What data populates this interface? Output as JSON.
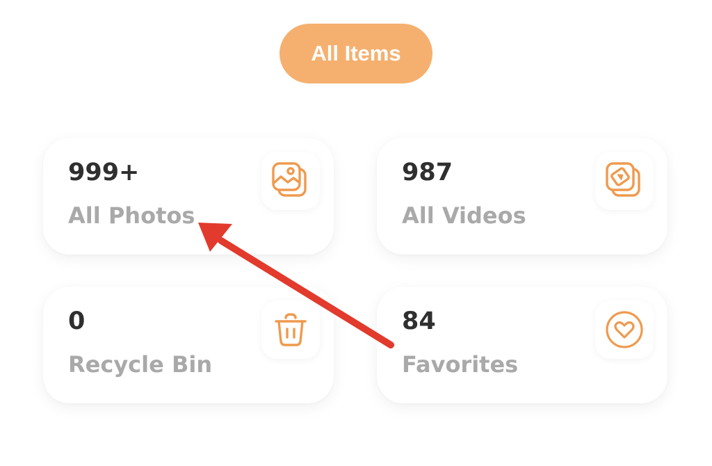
{
  "filter": {
    "label": "All Items"
  },
  "cards": [
    {
      "count": "999+",
      "label": "All Photos",
      "icon": "photos-icon"
    },
    {
      "count": "987",
      "label": "All Videos",
      "icon": "videos-icon"
    },
    {
      "count": "0",
      "label": "Recycle Bin",
      "icon": "trash-icon"
    },
    {
      "count": "84",
      "label": "Favorites",
      "icon": "heart-icon"
    }
  ],
  "colors": {
    "accent": "#f5b06f",
    "icon_stroke": "#ef9a4e",
    "count_text": "#2f2f2f",
    "label_text": "#a9a9a9",
    "annotation_arrow": "#e23a2c"
  }
}
